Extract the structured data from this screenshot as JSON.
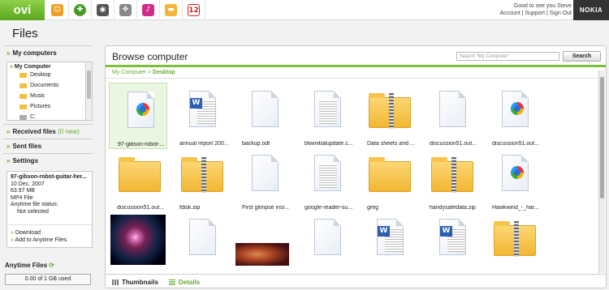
{
  "topbar": {
    "logo": "ovi",
    "apps": [
      "contacts-icon",
      "globe-icon",
      "camera-icon",
      "games-icon",
      "music-icon",
      "files-icon",
      "calendar-icon"
    ],
    "greeting": "Good to see you Steve",
    "links": [
      "Account",
      "Support",
      "Sign Out"
    ],
    "brand": "NOKIA"
  },
  "page_title": "Files",
  "sidebar": {
    "my_computers": "My computers",
    "tree_root": "My Computer",
    "tree_items": [
      "Desktop",
      "Documents",
      "Music",
      "Pictures",
      "C:"
    ],
    "received_files": "Received files",
    "received_count": "(0 new)",
    "sent_files": "Sent files",
    "settings": "Settings",
    "details": {
      "name": "97-gibson-robot-guitar-her...",
      "date": "10 Dec. 2007",
      "size": "63.97 MB",
      "type": "MP4 File",
      "status_label": "Anytime file status:",
      "status_value": "Not selected",
      "download": "Download",
      "add": "Add to Anytime Files"
    },
    "anytime_files": "Anytime Files",
    "quota": "0.00 of 1 GB used"
  },
  "panel": {
    "title": "Browse computer",
    "search_placeholder": "Search \"My Computer\"",
    "search_button": "Search",
    "breadcrumb_root": "My Computer",
    "breadcrumb_sep": ">",
    "breadcrumb_current": "Desktop",
    "files": [
      {
        "name": "97-gibson-robot-...",
        "kind": "media"
      },
      {
        "name": "annual report 200...",
        "kind": "word"
      },
      {
        "name": "backup.odt",
        "kind": "blank"
      },
      {
        "name": "btwinitialupdate.c...",
        "kind": "text"
      },
      {
        "name": "Data sheets and ...",
        "kind": "zipfolder"
      },
      {
        "name": "discussion51.out...",
        "kind": "blank"
      },
      {
        "name": "discussion51.out...",
        "kind": "media"
      },
      {
        "name": "discussion51.out...",
        "kind": "folder"
      },
      {
        "name": "fdisk.zip",
        "kind": "zipfolder"
      },
      {
        "name": "First glimpse insi...",
        "kind": "blank"
      },
      {
        "name": "google-reader-su...",
        "kind": "text"
      },
      {
        "name": "greg",
        "kind": "folder"
      },
      {
        "name": "handysafedata.zip",
        "kind": "zipfolder"
      },
      {
        "name": "Hawkwind_-_har...",
        "kind": "media"
      },
      {
        "name": "",
        "kind": "photo1"
      },
      {
        "name": "",
        "kind": "blank"
      },
      {
        "name": "",
        "kind": "photo2"
      },
      {
        "name": "",
        "kind": "blank"
      },
      {
        "name": "",
        "kind": "word"
      },
      {
        "name": "",
        "kind": "word"
      },
      {
        "name": "",
        "kind": "zipfolder"
      }
    ],
    "view_thumbnails": "Thumbnails",
    "view_details": "Details"
  }
}
